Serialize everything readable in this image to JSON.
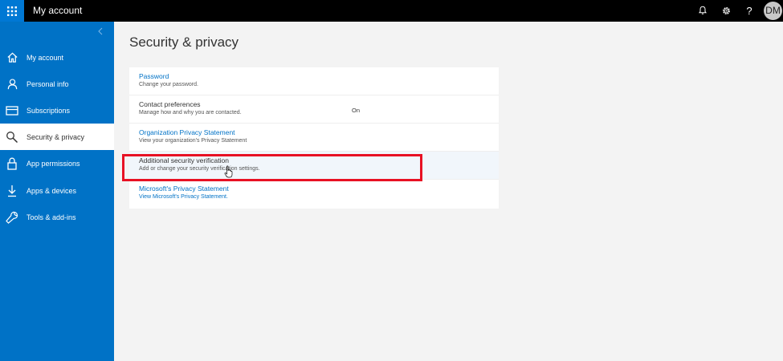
{
  "app": {
    "title": "My account"
  },
  "header": {
    "icons": [
      "waffle-icon",
      "bell-icon",
      "gear-icon",
      "help-icon"
    ],
    "avatar_initials": "DM"
  },
  "sidebar": {
    "items": [
      {
        "label": "My account",
        "icon": "home-icon",
        "active": false
      },
      {
        "label": "Personal info",
        "icon": "person-icon",
        "active": false
      },
      {
        "label": "Subscriptions",
        "icon": "card-icon",
        "active": false
      },
      {
        "label": "Security & privacy",
        "icon": "search-icon",
        "active": true
      },
      {
        "label": "App permissions",
        "icon": "lock-icon",
        "active": false
      },
      {
        "label": "Apps & devices",
        "icon": "download-icon",
        "active": false
      },
      {
        "label": "Tools & add-ins",
        "icon": "wrench-icon",
        "active": false
      }
    ]
  },
  "main": {
    "title": "Security & privacy",
    "rows": [
      {
        "title": "Password",
        "desc": "Change your password.",
        "value": ""
      },
      {
        "title": "Contact preferences",
        "desc": "Manage how and why you are contacted.",
        "value": "On"
      },
      {
        "title": "Organization Privacy Statement",
        "desc": "View your organization's Privacy Statement",
        "value": ""
      },
      {
        "title": "Additional security verification",
        "desc": "Add or change your security verification settings.",
        "value": ""
      },
      {
        "title": "Microsoft's Privacy Statement",
        "desc": "View Microsoft's Privacy Statement.",
        "value": ""
      }
    ]
  },
  "colors": {
    "brand_blue": "#0072c6",
    "top_bar": "#000000",
    "highlight_box": "#e81123",
    "link": "#0072c6"
  }
}
